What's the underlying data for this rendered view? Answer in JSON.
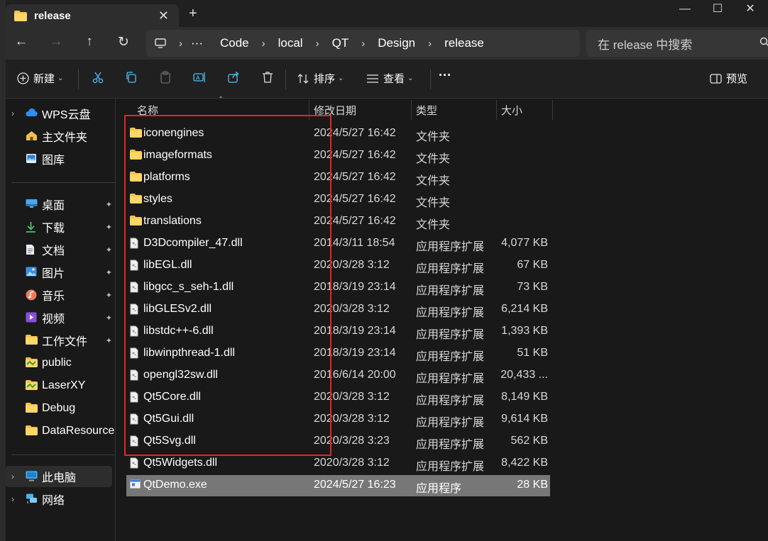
{
  "window": {
    "tab_title": "release",
    "tab_close": "✕",
    "new_tab": "+",
    "minimize": "—",
    "maximize": "☐",
    "close": "✕"
  },
  "nav": {
    "back": "←",
    "forward": "→",
    "up": "↑",
    "refresh": "↻",
    "more": "···",
    "breadcrumbs": [
      "Code",
      "local",
      "QT",
      "Design",
      "release"
    ],
    "separator": "›",
    "search_placeholder": "在 release 中搜索"
  },
  "toolbar": {
    "new_label": "新建",
    "sort_label": "排序",
    "view_label": "查看",
    "more": "···",
    "preview_label": "预览",
    "dropdown": "⌄"
  },
  "sidebar": {
    "items": [
      {
        "label": "WPS云盘",
        "icon": "cloud-icon",
        "chevron": "›",
        "pinned": false
      },
      {
        "label": "主文件夹",
        "icon": "home-icon",
        "chevron": "",
        "pinned": false
      },
      {
        "label": "图库",
        "icon": "gallery-icon",
        "chevron": "",
        "pinned": false
      },
      {
        "label": "桌面",
        "icon": "desktop-icon",
        "chevron": "",
        "pinned": true
      },
      {
        "label": "下载",
        "icon": "download-icon",
        "chevron": "",
        "pinned": true
      },
      {
        "label": "文档",
        "icon": "document-icon",
        "chevron": "",
        "pinned": true
      },
      {
        "label": "图片",
        "icon": "picture-icon",
        "chevron": "",
        "pinned": true
      },
      {
        "label": "音乐",
        "icon": "music-icon",
        "chevron": "",
        "pinned": true
      },
      {
        "label": "视频",
        "icon": "video-icon",
        "chevron": "",
        "pinned": true
      },
      {
        "label": "工作文件",
        "icon": "folder-icon",
        "chevron": "",
        "pinned": true
      },
      {
        "label": "public",
        "icon": "shared-folder-icon",
        "chevron": "",
        "pinned": false
      },
      {
        "label": "LaserXY",
        "icon": "shared-folder-icon",
        "chevron": "",
        "pinned": false
      },
      {
        "label": "Debug",
        "icon": "folder-icon",
        "chevron": "",
        "pinned": false
      },
      {
        "label": "DataResource",
        "icon": "folder-icon",
        "chevron": "",
        "pinned": false
      },
      {
        "label": "此电脑",
        "icon": "computer-icon",
        "chevron": "›",
        "pinned": false
      },
      {
        "label": "网络",
        "icon": "network-icon",
        "chevron": "›",
        "pinned": false
      }
    ],
    "pin_glyph": "📌"
  },
  "columns": {
    "name": "名称",
    "date": "修改日期",
    "type": "类型",
    "size": "大小",
    "sort_indicator": "⌃"
  },
  "files": [
    {
      "name": "iconengines",
      "date": "2024/5/27 16:42",
      "type": "文件夹",
      "size": "",
      "icon": "folder-icon"
    },
    {
      "name": "imageformats",
      "date": "2024/5/27 16:42",
      "type": "文件夹",
      "size": "",
      "icon": "folder-icon"
    },
    {
      "name": "platforms",
      "date": "2024/5/27 16:42",
      "type": "文件夹",
      "size": "",
      "icon": "folder-icon"
    },
    {
      "name": "styles",
      "date": "2024/5/27 16:42",
      "type": "文件夹",
      "size": "",
      "icon": "folder-icon"
    },
    {
      "name": "translations",
      "date": "2024/5/27 16:42",
      "type": "文件夹",
      "size": "",
      "icon": "folder-icon"
    },
    {
      "name": "D3Dcompiler_47.dll",
      "date": "2014/3/11 18:54",
      "type": "应用程序扩展",
      "size": "4,077 KB",
      "icon": "dll-file-icon"
    },
    {
      "name": "libEGL.dll",
      "date": "2020/3/28 3:12",
      "type": "应用程序扩展",
      "size": "67 KB",
      "icon": "dll-file-icon"
    },
    {
      "name": "libgcc_s_seh-1.dll",
      "date": "2018/3/19 23:14",
      "type": "应用程序扩展",
      "size": "73 KB",
      "icon": "dll-file-icon"
    },
    {
      "name": "libGLESv2.dll",
      "date": "2020/3/28 3:12",
      "type": "应用程序扩展",
      "size": "6,214 KB",
      "icon": "dll-file-icon"
    },
    {
      "name": "libstdc++-6.dll",
      "date": "2018/3/19 23:14",
      "type": "应用程序扩展",
      "size": "1,393 KB",
      "icon": "dll-file-icon"
    },
    {
      "name": "libwinpthread-1.dll",
      "date": "2018/3/19 23:14",
      "type": "应用程序扩展",
      "size": "51 KB",
      "icon": "dll-file-icon"
    },
    {
      "name": "opengl32sw.dll",
      "date": "2016/6/14 20:00",
      "type": "应用程序扩展",
      "size": "20,433 ...",
      "icon": "dll-file-icon"
    },
    {
      "name": "Qt5Core.dll",
      "date": "2020/3/28 3:12",
      "type": "应用程序扩展",
      "size": "8,149 KB",
      "icon": "dll-file-icon"
    },
    {
      "name": "Qt5Gui.dll",
      "date": "2020/3/28 3:12",
      "type": "应用程序扩展",
      "size": "9,614 KB",
      "icon": "dll-file-icon"
    },
    {
      "name": "Qt5Svg.dll",
      "date": "2020/3/28 3:23",
      "type": "应用程序扩展",
      "size": "562 KB",
      "icon": "dll-file-icon"
    },
    {
      "name": "Qt5Widgets.dll",
      "date": "2020/3/28 3:12",
      "type": "应用程序扩展",
      "size": "8,422 KB",
      "icon": "dll-file-icon"
    },
    {
      "name": "QtDemo.exe",
      "date": "2024/5/27 16:23",
      "type": "应用程序",
      "size": "28 KB",
      "icon": "exe-file-icon",
      "selected": true
    }
  ],
  "colors": {
    "background": "#191919",
    "selection": "#777777",
    "folder": "#f4c34d",
    "highlight_box": "#e0281e",
    "accent": "#4cc2ff"
  }
}
